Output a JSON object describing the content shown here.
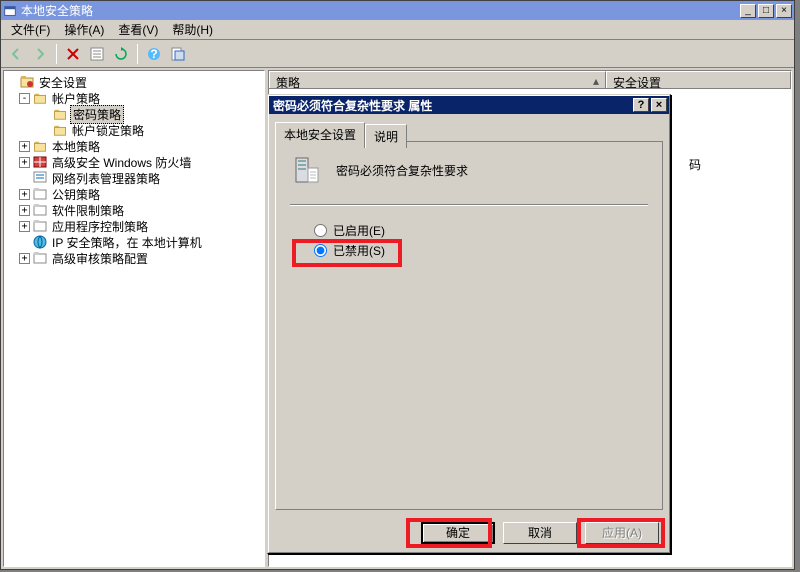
{
  "window": {
    "title": "本地安全策略",
    "buttons": {
      "min": "_",
      "max": "□",
      "close": "×"
    }
  },
  "menu": {
    "file": "文件(F)",
    "action": "操作(A)",
    "view": "查看(V)",
    "help": "帮助(H)"
  },
  "toolbar_icons": {
    "back": "back-icon",
    "forward": "forward-icon",
    "delete": "delete-icon",
    "export": "export-icon",
    "refresh": "refresh-icon",
    "help": "help-icon",
    "props": "properties-icon"
  },
  "tree": {
    "root": "安全设置",
    "account": "帐户策略",
    "password": "密码策略",
    "lockout": "帐户锁定策略",
    "local": "本地策略",
    "firewall": "高级安全 Windows 防火墙",
    "network_list": "网络列表管理器策略",
    "pubkey": "公钥策略",
    "software": "软件限制策略",
    "appctrl": "应用程序控制策略",
    "ipsec": "IP 安全策略，在 本地计算机",
    "audit": "高级审核策略配置"
  },
  "list": {
    "col_policy": "策略",
    "col_security": "安全设置",
    "peek": "码"
  },
  "dialog": {
    "title": "密码必须符合复杂性要求 属性",
    "tab_local": "本地安全设置",
    "tab_explain": "说明",
    "header_text": "密码必须符合复杂性要求",
    "radio_enabled": "已启用(E)",
    "radio_disabled": "已禁用(S)",
    "btn_ok": "确定",
    "btn_cancel": "取消",
    "btn_apply": "应用(A)",
    "help_btn": "?",
    "close_btn": "×"
  }
}
